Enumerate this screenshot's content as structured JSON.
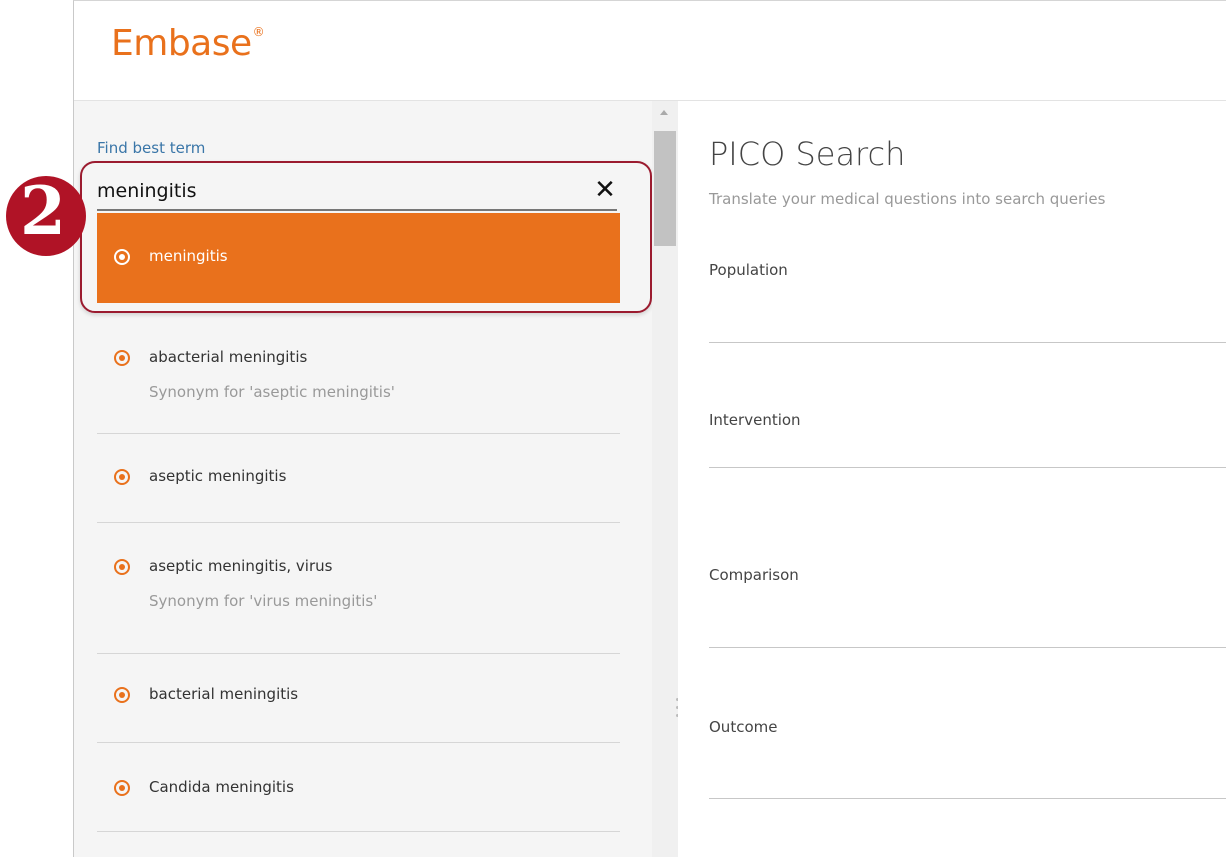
{
  "header": {
    "logo_text": "Embase",
    "logo_mark": "®"
  },
  "step_badge": "2",
  "search": {
    "label": "Find best term",
    "value": "meningitis",
    "clear_icon": "close-icon",
    "clear_glyph": "✕"
  },
  "term_list": [
    {
      "label": "meningitis",
      "synonym": "",
      "selected": true
    },
    {
      "label": "abacterial meningitis",
      "synonym": "Synonym for 'aseptic meningitis'",
      "selected": false
    },
    {
      "label": "aseptic meningitis",
      "synonym": "",
      "selected": false
    },
    {
      "label": "aseptic meningitis, virus",
      "synonym": "Synonym for 'virus meningitis'",
      "selected": false
    },
    {
      "label": "bacterial meningitis",
      "synonym": "",
      "selected": false
    },
    {
      "label": "Candida meningitis",
      "synonym": "",
      "selected": false
    }
  ],
  "pico": {
    "title": "PICO Search",
    "subtitle": "Translate your medical questions into search queries",
    "fields": [
      {
        "label": "Population"
      },
      {
        "label": "Intervention"
      },
      {
        "label": "Comparison"
      },
      {
        "label": "Outcome"
      }
    ]
  },
  "colors": {
    "accent": "#e9711c",
    "badge": "#b01326",
    "link": "#3a76a8"
  }
}
